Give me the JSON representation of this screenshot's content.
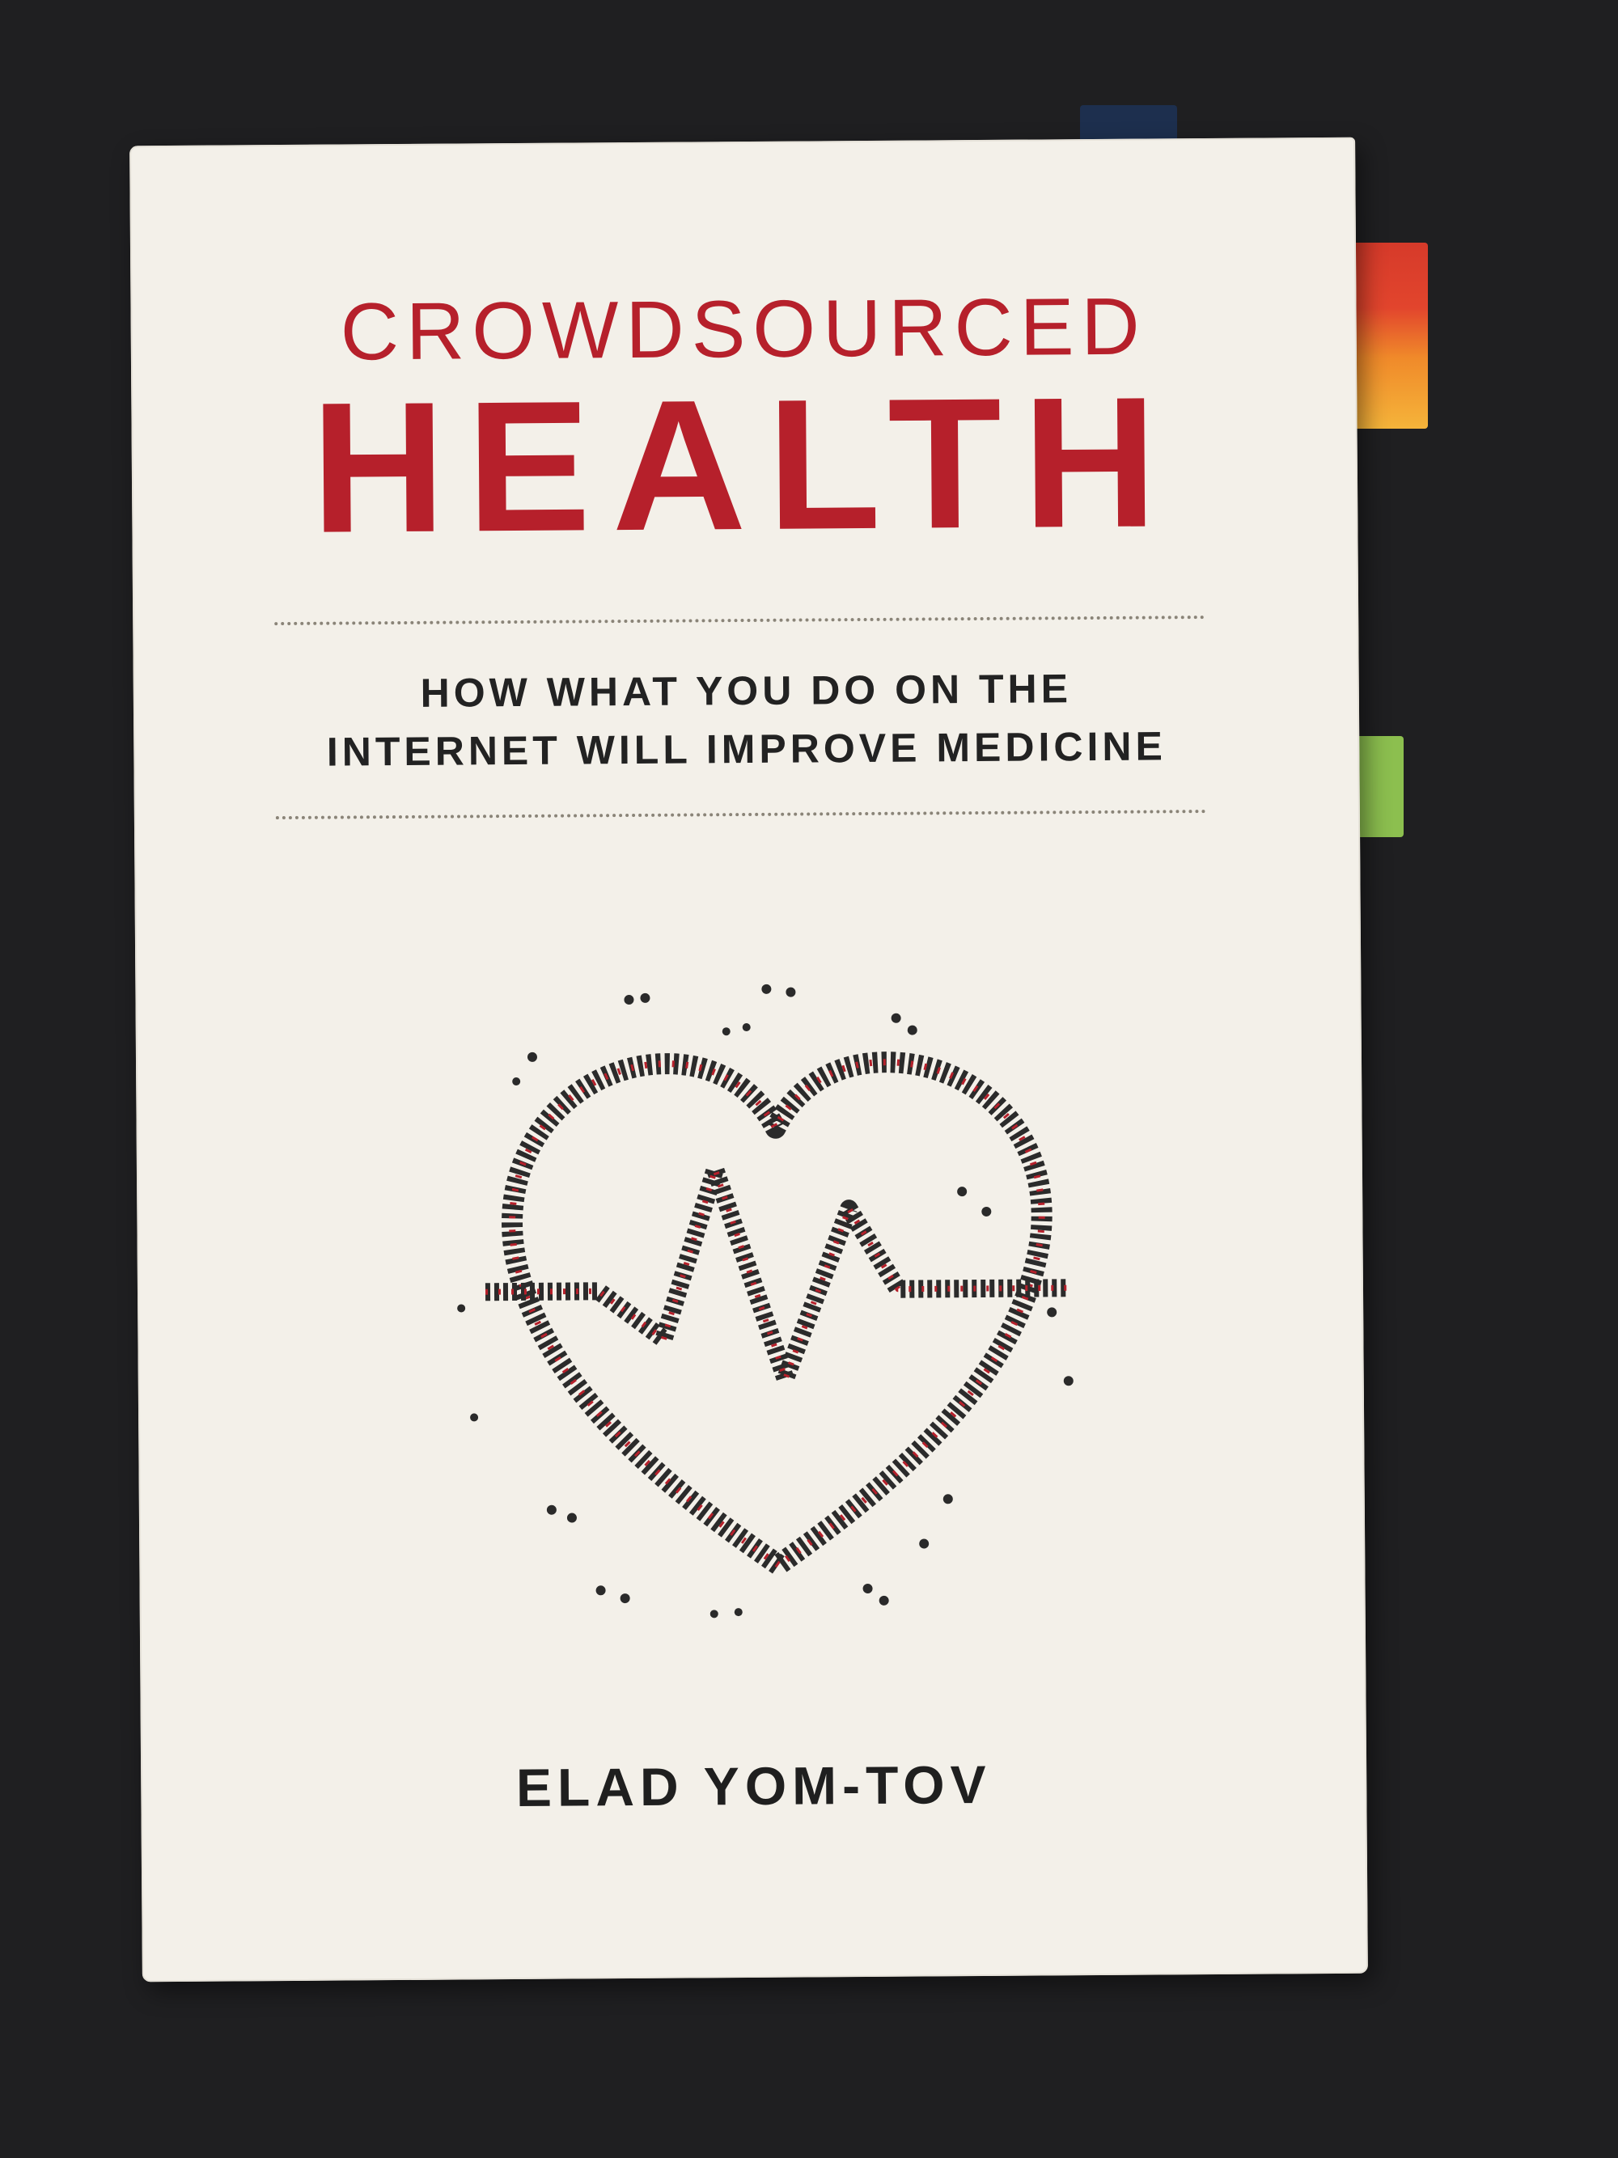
{
  "cover": {
    "title_line_1": "CROWDSOURCED",
    "title_line_2": "HEALTH",
    "subtitle_line_1": "HOW WHAT YOU DO ON THE",
    "subtitle_line_2": "INTERNET WILL IMPROVE MEDICINE",
    "author": "ELAD YOM-TOV",
    "illustration_icon": "heart-with-heartbeat-crowd-icon"
  },
  "colors": {
    "background": "#1f1f21",
    "cover": "#f3f0e9",
    "title": "#b6202b",
    "text": "#222222"
  }
}
